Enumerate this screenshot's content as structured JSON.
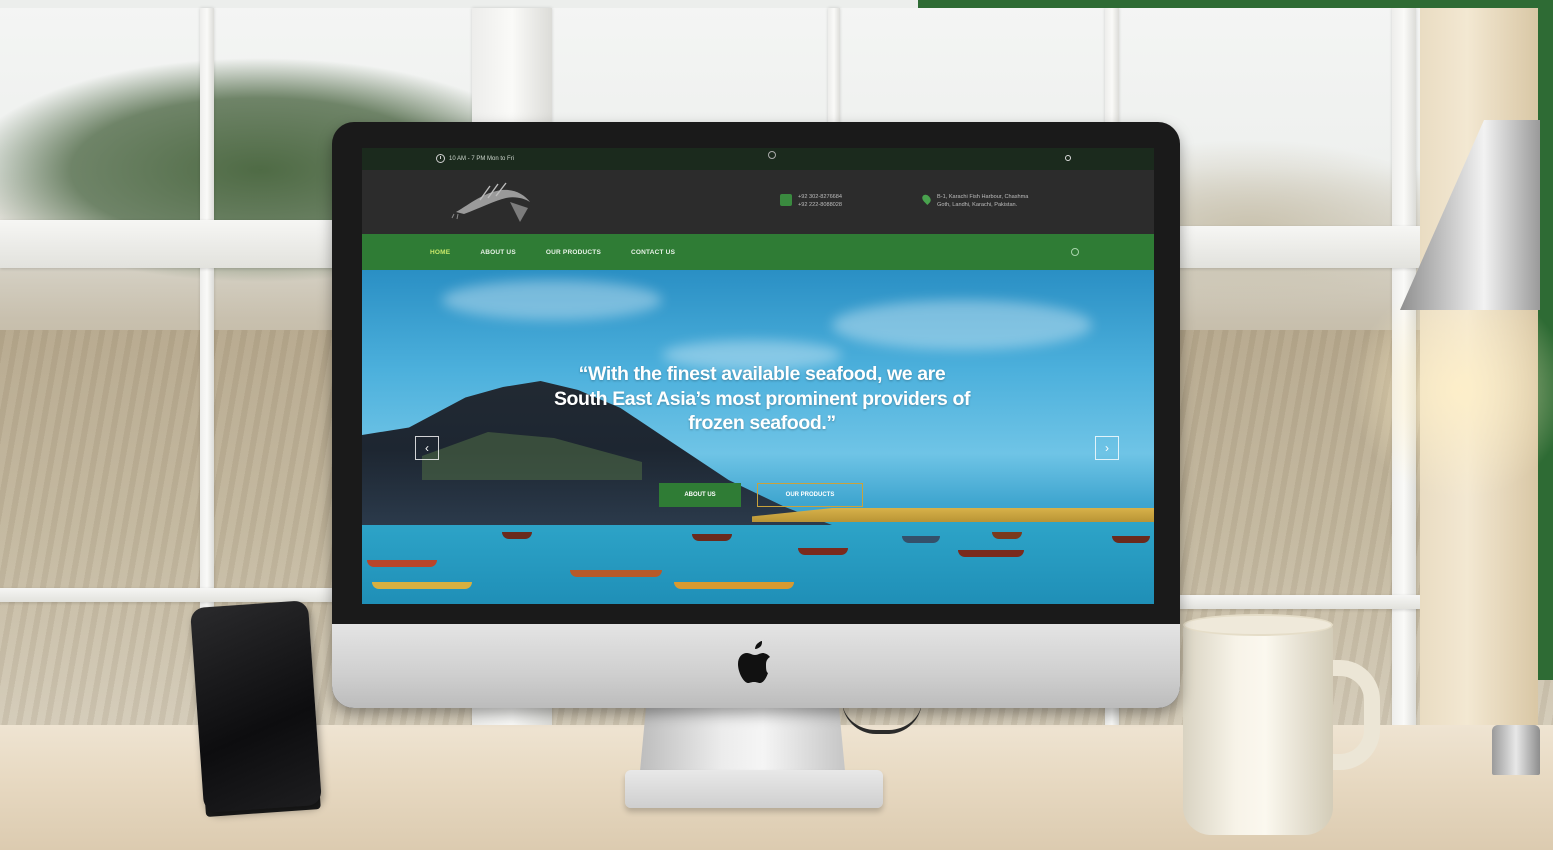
{
  "website": {
    "topbar": {
      "hours": "10 AM - 7 PM Mon to Fri"
    },
    "contact": {
      "phones": [
        "+92 302-8276684",
        "+92 222-8088028"
      ],
      "address_line1": "B-1, Karachi Fish Harbour, Chashma",
      "address_line2": "Goth, Landhi, Karachi, Pakistan."
    },
    "nav": {
      "items": [
        "HOME",
        "ABOUT US",
        "OUR PRODUCTS",
        "CONTACT US"
      ]
    },
    "hero": {
      "headline": "“With the finest available seafood, we are South East Asia’s most prominent providers of frozen seafood.”",
      "primary_button": "ABOUT US",
      "secondary_button": "OUR PRODUCTS",
      "prev_arrow": "‹",
      "next_arrow": "›"
    },
    "colors": {
      "brand_green": "#2f7c35",
      "topbar": "#1b2a1d",
      "header": "#2c2c2c",
      "accent_gold": "#c9a23c"
    }
  },
  "icons": [
    "clock-icon",
    "search-icon",
    "phone-icon",
    "location-pin-icon",
    "apple-logo-icon",
    "chevron-left-icon",
    "chevron-right-icon"
  ]
}
